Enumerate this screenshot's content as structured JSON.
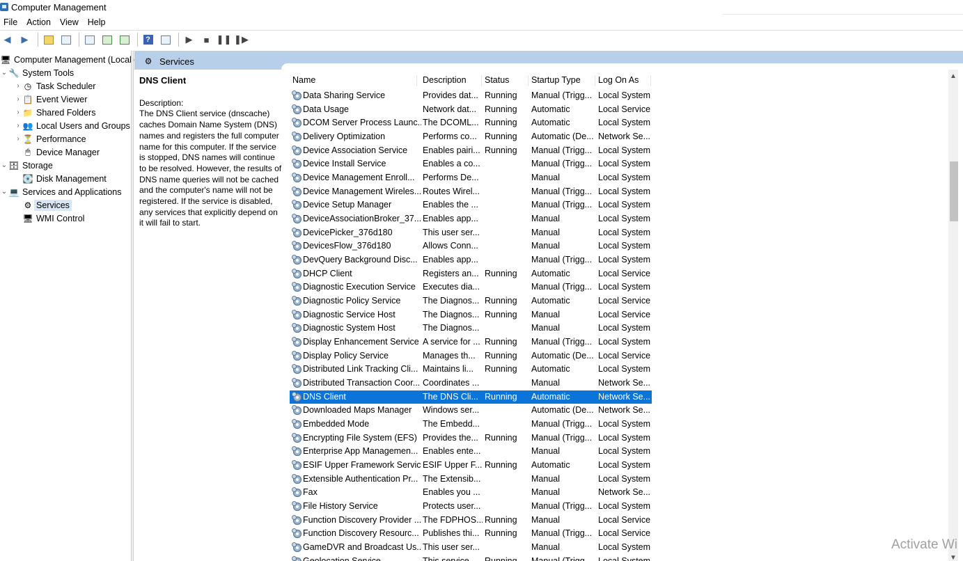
{
  "window": {
    "title": "Computer Management"
  },
  "menu": [
    "File",
    "Action",
    "View",
    "Help"
  ],
  "tree": {
    "root": "Computer Management (Local)",
    "system_tools": "System Tools",
    "task_scheduler": "Task Scheduler",
    "event_viewer": "Event Viewer",
    "shared_folders": "Shared Folders",
    "local_users": "Local Users and Groups",
    "performance": "Performance",
    "device_manager": "Device Manager",
    "storage": "Storage",
    "disk_management": "Disk Management",
    "services_apps": "Services and Applications",
    "services": "Services",
    "wmi": "WMI Control"
  },
  "panel": {
    "title": "Services"
  },
  "detail": {
    "name": "DNS Client",
    "label": "Description:",
    "text": "The DNS Client service (dnscache) caches Domain Name System (DNS) names and registers the full computer name for this computer. If the service is stopped, DNS names will continue to be resolved. However, the results of DNS name queries will not be cached and the computer's name will not be registered. If the service is disabled, any services that explicitly depend on it will fail to start."
  },
  "columns": {
    "name": "Name",
    "description": "Description",
    "status": "Status",
    "startup": "Startup Type",
    "logon": "Log On As"
  },
  "services": [
    [
      "Data Sharing Service",
      "Provides dat...",
      "Running",
      "Manual (Trigg...",
      "Local System"
    ],
    [
      "Data Usage",
      "Network dat...",
      "Running",
      "Automatic",
      "Local Service"
    ],
    [
      "DCOM Server Process Launc...",
      "The DCOML...",
      "Running",
      "Automatic",
      "Local System"
    ],
    [
      "Delivery Optimization",
      "Performs co...",
      "Running",
      "Automatic (De...",
      "Network Se..."
    ],
    [
      "Device Association Service",
      "Enables pairi...",
      "Running",
      "Manual (Trigg...",
      "Local System"
    ],
    [
      "Device Install Service",
      "Enables a co...",
      "",
      "Manual (Trigg...",
      "Local System"
    ],
    [
      "Device Management Enroll...",
      "Performs De...",
      "",
      "Manual",
      "Local System"
    ],
    [
      "Device Management Wireles...",
      "Routes Wirel...",
      "",
      "Manual (Trigg...",
      "Local System"
    ],
    [
      "Device Setup Manager",
      "Enables the ...",
      "",
      "Manual (Trigg...",
      "Local System"
    ],
    [
      "DeviceAssociationBroker_37...",
      "Enables app...",
      "",
      "Manual",
      "Local System"
    ],
    [
      "DevicePicker_376d180",
      "This user ser...",
      "",
      "Manual",
      "Local System"
    ],
    [
      "DevicesFlow_376d180",
      "Allows Conn...",
      "",
      "Manual",
      "Local System"
    ],
    [
      "DevQuery Background Disc...",
      "Enables app...",
      "",
      "Manual (Trigg...",
      "Local System"
    ],
    [
      "DHCP Client",
      "Registers an...",
      "Running",
      "Automatic",
      "Local Service"
    ],
    [
      "Diagnostic Execution Service",
      "Executes dia...",
      "",
      "Manual (Trigg...",
      "Local System"
    ],
    [
      "Diagnostic Policy Service",
      "The Diagnos...",
      "Running",
      "Automatic",
      "Local Service"
    ],
    [
      "Diagnostic Service Host",
      "The Diagnos...",
      "Running",
      "Manual",
      "Local Service"
    ],
    [
      "Diagnostic System Host",
      "The Diagnos...",
      "",
      "Manual",
      "Local System"
    ],
    [
      "Display Enhancement Service",
      "A service for ...",
      "Running",
      "Manual (Trigg...",
      "Local System"
    ],
    [
      "Display Policy Service",
      "Manages th...",
      "Running",
      "Automatic (De...",
      "Local Service"
    ],
    [
      "Distributed Link Tracking Cli...",
      "Maintains li...",
      "Running",
      "Automatic",
      "Local System"
    ],
    [
      "Distributed Transaction Coor...",
      "Coordinates ...",
      "",
      "Manual",
      "Network Se..."
    ],
    [
      "DNS Client",
      "The DNS Cli...",
      "Running",
      "Automatic",
      "Network Se..."
    ],
    [
      "Downloaded Maps Manager",
      "Windows ser...",
      "",
      "Automatic (De...",
      "Network Se..."
    ],
    [
      "Embedded Mode",
      "The Embedd...",
      "",
      "Manual (Trigg...",
      "Local System"
    ],
    [
      "Encrypting File System (EFS)",
      "Provides the...",
      "Running",
      "Manual (Trigg...",
      "Local System"
    ],
    [
      "Enterprise App Managemen...",
      "Enables ente...",
      "",
      "Manual",
      "Local System"
    ],
    [
      "ESIF Upper Framework Service",
      "ESIF Upper F...",
      "Running",
      "Automatic",
      "Local System"
    ],
    [
      "Extensible Authentication Pr...",
      "The Extensib...",
      "",
      "Manual",
      "Local System"
    ],
    [
      "Fax",
      "Enables you ...",
      "",
      "Manual",
      "Network Se..."
    ],
    [
      "File History Service",
      "Protects user...",
      "",
      "Manual (Trigg...",
      "Local System"
    ],
    [
      "Function Discovery Provider ...",
      "The FDPHOS...",
      "Running",
      "Manual",
      "Local Service"
    ],
    [
      "Function Discovery Resourc...",
      "Publishes thi...",
      "Running",
      "Manual (Trigg...",
      "Local Service"
    ],
    [
      "GameDVR and Broadcast Us...",
      "This user ser...",
      "",
      "Manual",
      "Local System"
    ],
    [
      "Geolocation Service",
      "This service ...",
      "Running",
      "Manual (Trigg...",
      "Local System"
    ]
  ],
  "selected_service": "DNS Client",
  "watermark": "Activate Wi"
}
